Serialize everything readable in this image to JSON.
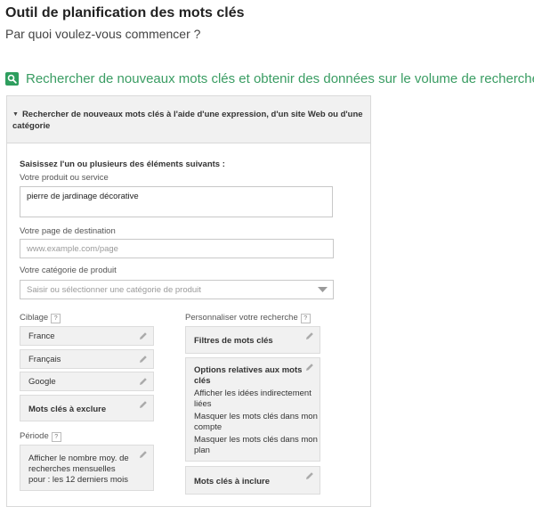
{
  "header": {
    "title": "Outil de planification des mots clés",
    "subtitle": "Par quoi voulez-vous commencer ?"
  },
  "section": {
    "icon": "search-icon",
    "title": "Rechercher de nouveaux mots clés et obtenir des données sur le volume de recherche"
  },
  "panel": {
    "header": "Rechercher de nouveaux mots clés à l'aide d'une expression, d'un site Web ou d'une catégorie",
    "intro": "Saisissez l'un ou plusieurs des éléments suivants :",
    "product": {
      "label": "Votre produit ou service",
      "value": "pierre de jardinage décorative"
    },
    "landing": {
      "label": "Votre page de destination",
      "placeholder": "www.example.com/page"
    },
    "category": {
      "label": "Votre catégorie de produit",
      "placeholder": "Saisir ou sélectionner une catégorie de produit"
    },
    "targeting": {
      "label": "Ciblage",
      "help": "?",
      "items": [
        "France",
        "Français",
        "Google"
      ],
      "negative": "Mots clés à exclure"
    },
    "period": {
      "label": "Période",
      "help": "?",
      "text": [
        "Afficher le nombre moy. de",
        "recherches mensuelles",
        "pour : les 12 derniers mois"
      ]
    },
    "customize": {
      "label": "Personnaliser votre recherche",
      "help": "?",
      "filters": "Filtres de mots clés",
      "options_title": [
        "Options relatives aux mots",
        "clés"
      ],
      "options_lines": [
        [
          "Afficher les idées indirectement",
          "liées"
        ],
        [
          "Masquer les mots clés dans mon",
          "compte"
        ],
        [
          "Masquer les mots clés dans mon",
          "plan"
        ]
      ],
      "include": "Mots clés à inclure"
    }
  },
  "colors": {
    "accent": "#3a9d63",
    "icon_bg": "#2e9e5e",
    "card_bg": "#f1f1f1"
  }
}
